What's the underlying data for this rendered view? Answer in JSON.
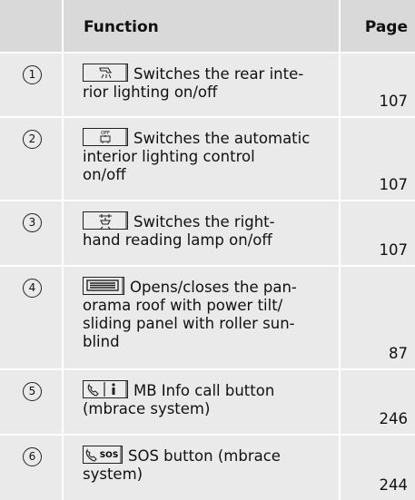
{
  "header": {
    "function": "Function",
    "page": "Page"
  },
  "rows": [
    {
      "num": "1",
      "icon": "rear-interior-light-icon",
      "text": "Switches the rear interior lighting on/off",
      "text_lines": [
        "Switches the rear inte-",
        "rior lighting on/off"
      ],
      "page": "107"
    },
    {
      "num": "2",
      "icon": "auto-interior-light-off-icon",
      "icon_label": "OFF",
      "text": "Switches the automatic interior lighting control on/off",
      "text_lines": [
        "Switches the automatic",
        "interior lighting control",
        "on/off"
      ],
      "page": "107"
    },
    {
      "num": "3",
      "icon": "reading-lamp-icon",
      "text": "Switches the right-hand reading lamp on/off",
      "text_lines": [
        "Switches the right-",
        "hand reading lamp on/off"
      ],
      "page": "107"
    },
    {
      "num": "4",
      "icon": "panorama-roof-icon",
      "text": "Opens/closes the panorama roof with power tilt/sliding panel with roller sunblind",
      "text_lines": [
        "Opens/closes the pan-",
        "orama roof with power tilt/",
        "sliding panel with roller sun-",
        "blind"
      ],
      "page": "87"
    },
    {
      "num": "5",
      "icon": "mb-info-call-icon",
      "text": "MB Info call button (mbrace system)",
      "text_lines": [
        "MB Info call button",
        "(mbrace system)"
      ],
      "page": "246"
    },
    {
      "num": "6",
      "icon": "sos-icon",
      "icon_label": "SOS",
      "text": "SOS button (mbrace system)",
      "text_lines": [
        "SOS button (mbrace",
        "system)"
      ],
      "page": "244"
    }
  ]
}
